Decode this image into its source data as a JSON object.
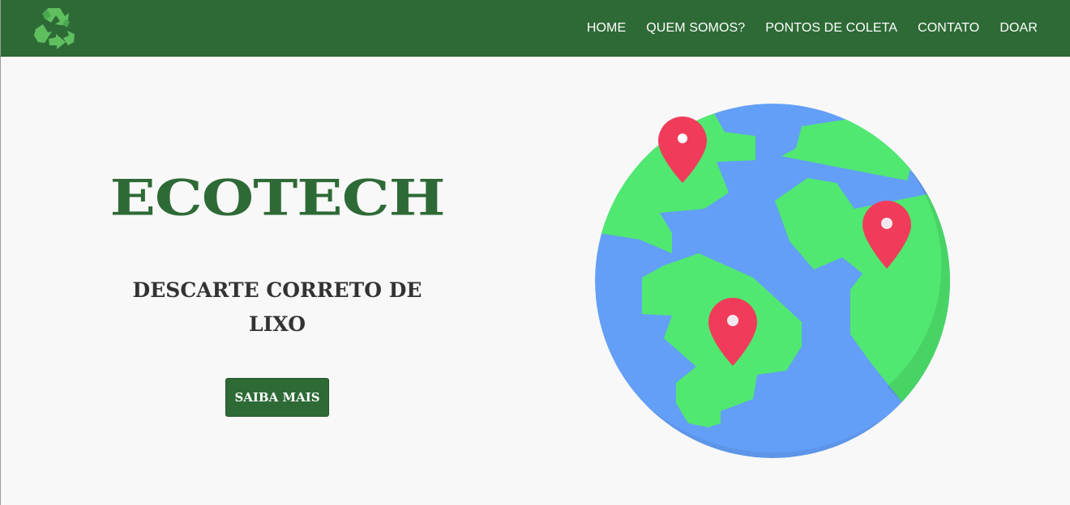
{
  "header": {
    "logo_icon": "recycle-icon",
    "nav": [
      {
        "label": "HOME"
      },
      {
        "label": "QUEM SOMOS?"
      },
      {
        "label": "PONTOS DE COLETA"
      },
      {
        "label": "CONTATO"
      },
      {
        "label": "DOAR"
      }
    ]
  },
  "hero": {
    "title": "ECOTECH",
    "subtitle": "DESCARTE CORRETO DE LIXO",
    "button_label": "SAIBA MAIS",
    "illustration_icon": "globe-with-location-pins-icon"
  },
  "colors": {
    "brand_green": "#2e6a36",
    "background": "#f8f8f8",
    "ocean_blue": "#639ff7",
    "land_green": "#50e870",
    "pin_red": "#f03c5a"
  }
}
